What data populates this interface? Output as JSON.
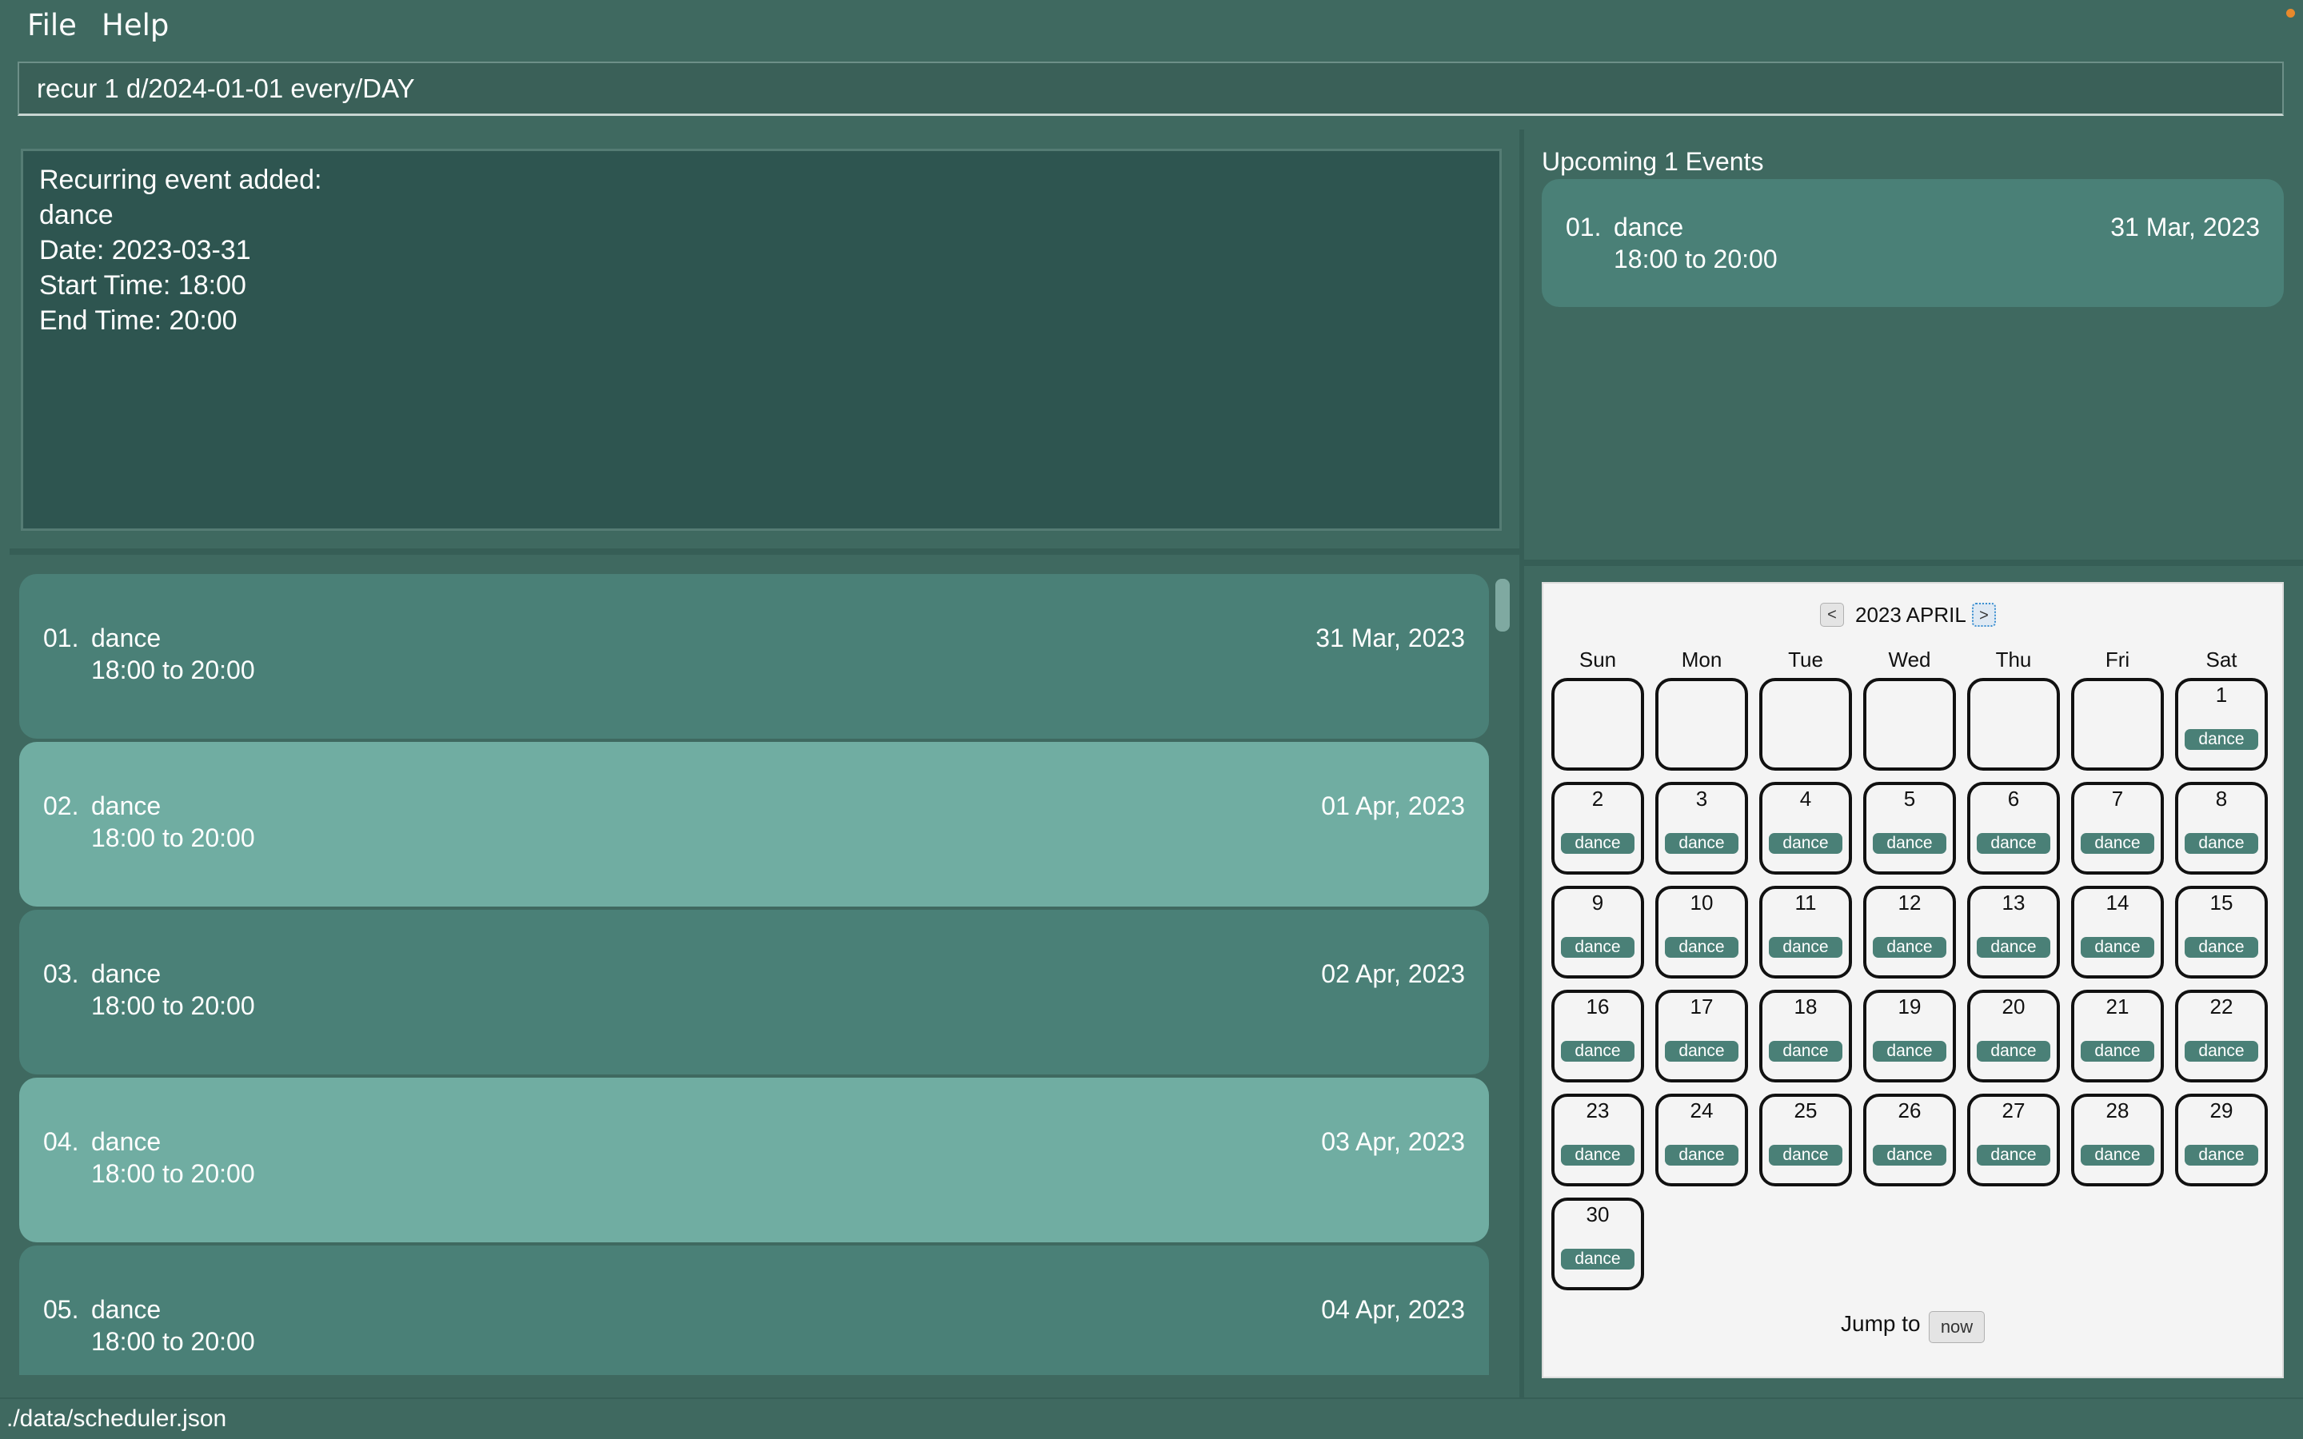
{
  "menu": {
    "file": "File",
    "help": "Help"
  },
  "command": {
    "value": "recur 1 d/2024-01-01 every/DAY"
  },
  "result": {
    "lines": [
      "Recurring event added:",
      "dance",
      "Date: 2023-03-31",
      "Start Time: 18:00",
      "End Time: 20:00"
    ]
  },
  "events": [
    {
      "index": "01.",
      "name": "dance",
      "time": "18:00  to  20:00",
      "date": "31 Mar, 2023"
    },
    {
      "index": "02.",
      "name": "dance",
      "time": "18:00  to  20:00",
      "date": "01 Apr, 2023"
    },
    {
      "index": "03.",
      "name": "dance",
      "time": "18:00  to  20:00",
      "date": "02 Apr, 2023"
    },
    {
      "index": "04.",
      "name": "dance",
      "time": "18:00  to  20:00",
      "date": "03 Apr, 2023"
    },
    {
      "index": "05.",
      "name": "dance",
      "time": "18:00  to  20:00",
      "date": "04 Apr, 2023"
    }
  ],
  "upcoming": {
    "title": "Upcoming 1 Events",
    "items": [
      {
        "index": "01.",
        "name": "dance",
        "time": "18:00  to  20:00",
        "date": "31 Mar, 2023"
      }
    ]
  },
  "calendar": {
    "title": "2023  APRIL",
    "prev": "<",
    "next": ">",
    "weekdays": [
      "Sun",
      "Mon",
      "Tue",
      "Wed",
      "Thu",
      "Fri",
      "Sat"
    ],
    "first_weekday_index": 6,
    "days_in_month": 30,
    "event_label": "dance",
    "jump_label": "Jump to",
    "now_label": "now"
  },
  "status": {
    "path": "./data/scheduler.json"
  },
  "colors": {
    "background": "#3f6960",
    "card_dark": "#4a8077",
    "card_light": "#70ada2",
    "result_bg": "#2e5550"
  }
}
